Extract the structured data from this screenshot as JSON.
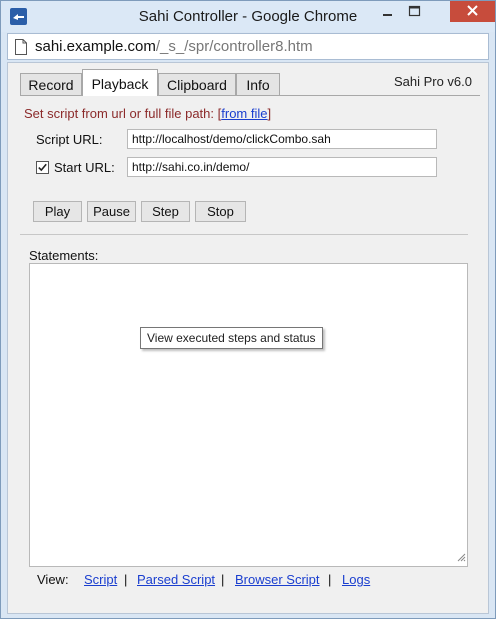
{
  "window": {
    "title": "Sahi Controller - Google Chrome"
  },
  "address": {
    "host": "sahi.example.com",
    "path": "/_s_/spr/controller8.htm"
  },
  "tabs": [
    {
      "label": "Record",
      "active": false
    },
    {
      "label": "Playback",
      "active": true
    },
    {
      "label": "Clipboard",
      "active": false
    },
    {
      "label": "Info",
      "active": false
    }
  ],
  "version": "Sahi Pro v6.0",
  "playback": {
    "hint_text": "Set script from url or full file path:",
    "hint_link_open": "[",
    "hint_link": "from file",
    "hint_link_close": "]",
    "script_url_label": "Script URL:",
    "script_url_value": "http://localhost/demo/clickCombo.sah",
    "start_url_label": "Start URL:",
    "start_url_value": "http://sahi.co.in/demo/",
    "start_url_checked": true,
    "buttons": {
      "play": "Play",
      "pause": "Pause",
      "step": "Step",
      "stop": "Stop"
    },
    "statements_label": "Statements:",
    "tooltip": "View executed steps and status"
  },
  "view_links": {
    "label": "View:",
    "script": "Script",
    "parsed_script": "Parsed Script",
    "browser_script": "Browser Script",
    "logs": "Logs",
    "separator": "|"
  }
}
